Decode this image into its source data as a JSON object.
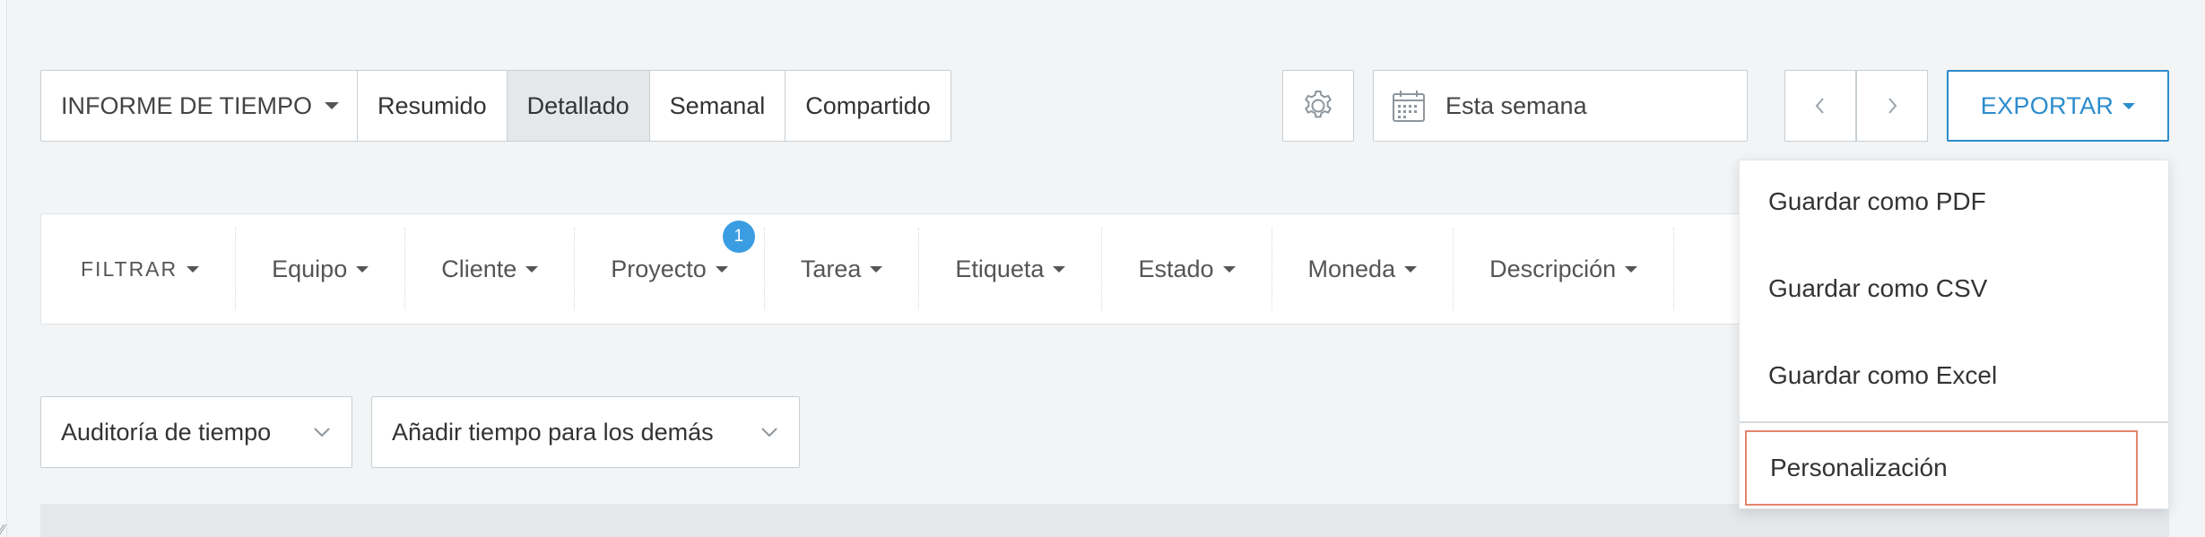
{
  "report_tabs": {
    "report_type": "INFORME DE TIEMPO",
    "items": [
      "Resumido",
      "Detallado",
      "Semanal",
      "Compartido"
    ],
    "active": "Detallado"
  },
  "date_range": {
    "label": "Esta semana",
    "prev_icon": "chevron-left-icon",
    "next_icon": "chevron-right-icon"
  },
  "settings": {
    "icon": "gear-icon"
  },
  "export": {
    "label": "EXPORTAR",
    "menu": {
      "pdf": "Guardar como PDF",
      "csv": "Guardar como CSV",
      "excel": "Guardar como Excel",
      "customize": "Personalización"
    }
  },
  "filters": {
    "label": "FILTRAR",
    "team": "Equipo",
    "client": "Cliente",
    "project": "Proyecto",
    "project_badge": "1",
    "task": "Tarea",
    "tag": "Etiqueta",
    "status": "Estado",
    "currency": "Moneda",
    "description": "Descripción"
  },
  "actions": {
    "audit": "Auditoría de tiempo",
    "add_time": "Añadir tiempo para los demás"
  },
  "colors": {
    "accent": "#2b8ccd",
    "badge": "#3b9de1",
    "focus_outline": "#e3856b",
    "active_segment": "#e4e8eb"
  }
}
